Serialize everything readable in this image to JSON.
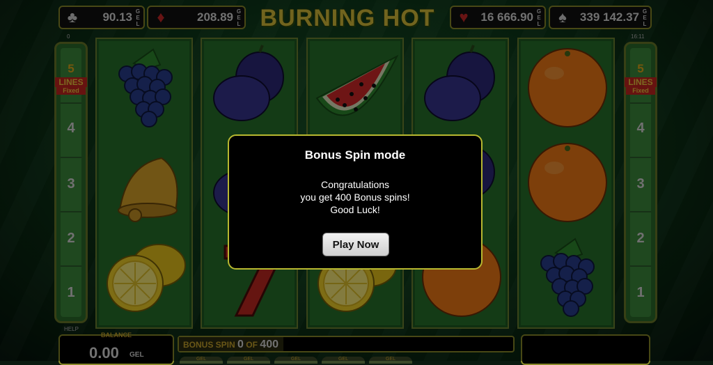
{
  "jackpots": [
    {
      "suit": "clubs-icon",
      "value": "90.13",
      "currency": "GEL"
    },
    {
      "suit": "diamonds-icon",
      "value": "208.89",
      "currency": "GEL"
    },
    {
      "suit": "hearts-icon",
      "value": "16 666.90",
      "currency": "GEL"
    },
    {
      "suit": "spades-icon",
      "value": "339 142.37",
      "currency": "GEL"
    }
  ],
  "game_title": "BURNING HOT",
  "top_left_tiny": "0",
  "top_right_tiny": "16:11",
  "lines": {
    "count": "5",
    "label": "LINES",
    "fixed": "Fixed",
    "numbers": [
      "4",
      "3",
      "2",
      "1"
    ]
  },
  "reels": [
    [
      "grapes",
      "bell",
      "lemon"
    ],
    [
      "plum",
      "plum",
      "seven"
    ],
    [
      "watermelon",
      "plum",
      "lemon"
    ],
    [
      "plum",
      "plum",
      "orange"
    ],
    [
      "orange",
      "orange",
      "grapes"
    ]
  ],
  "help_label": "HELP",
  "balance": {
    "title": "BALANCE",
    "value": "0.00",
    "currency": "GEL"
  },
  "bonus_spin": {
    "label": "BONUS SPIN",
    "current": "0",
    "of": "OF",
    "total": "400"
  },
  "bottom_tabs": [
    "GEL",
    "GEL",
    "GEL",
    "GEL",
    "GEL"
  ],
  "modal": {
    "title": "Bonus Spin mode",
    "line1": "Congratulations",
    "line2": "you get 400 Bonus spins!",
    "line3": "Good Luck!",
    "button": "Play Now"
  },
  "colors": {
    "accent": "#c9a62c",
    "frame": "#8a8a2a",
    "reel_bg": "#27722b",
    "modal_border": "#b8b830"
  }
}
